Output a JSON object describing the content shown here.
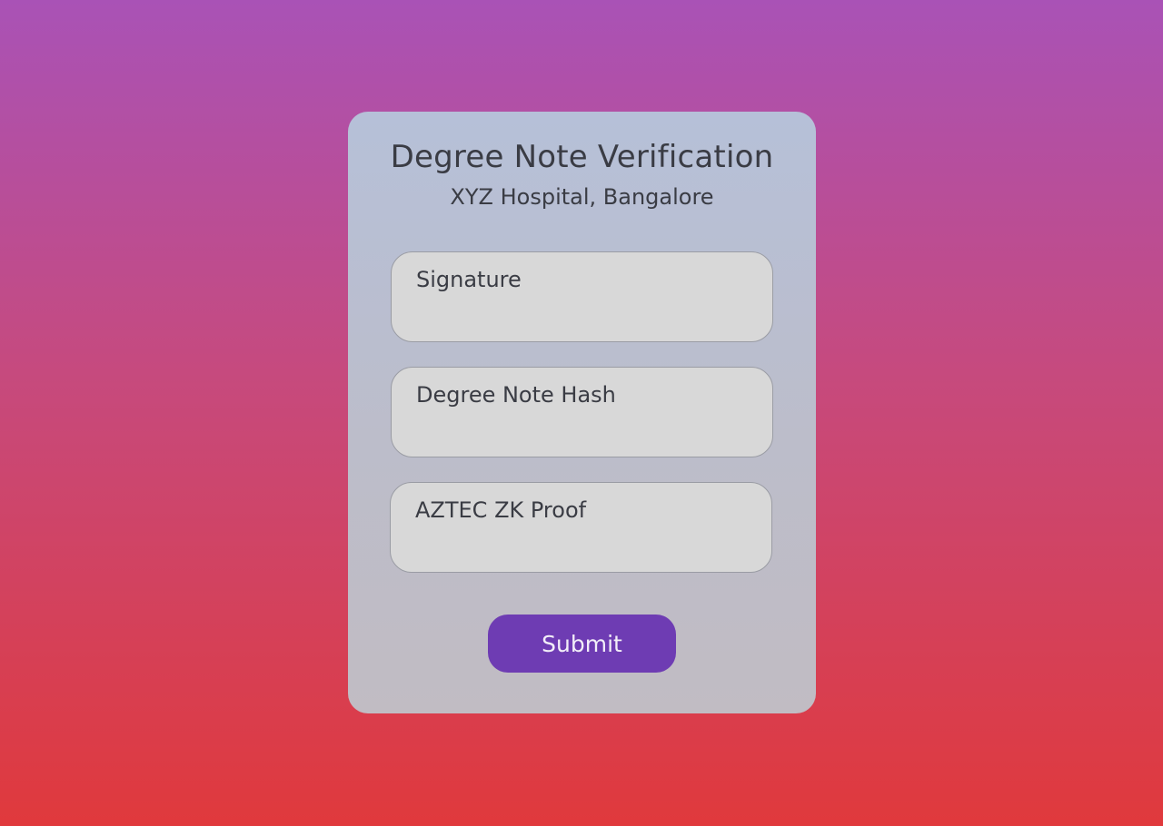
{
  "form": {
    "title": "Degree Note Verification",
    "subtitle": "XYZ Hospital, Bangalore",
    "fields": [
      {
        "placeholder": "Signature"
      },
      {
        "placeholder": "Degree Note Hash"
      },
      {
        "placeholder": "AZTEC ZK Proof"
      }
    ],
    "submit_label": "Submit"
  },
  "colors": {
    "background_top": "#a952b6",
    "background_bottom": "#e0393c",
    "card": "#bcbdca",
    "field": "#d8d8d8",
    "accent": "#6e3cb3",
    "text": "#3a3c44"
  }
}
